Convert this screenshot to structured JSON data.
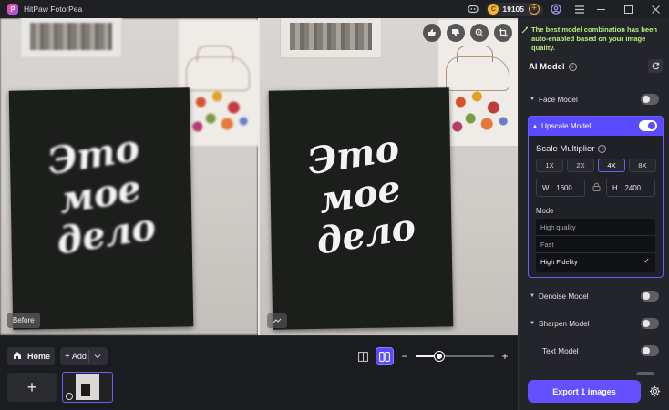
{
  "app": {
    "title": "HitPaw FotorPea",
    "logo_letter": "P"
  },
  "titlebar": {
    "credits": "19105",
    "coin_symbol": "C"
  },
  "viewer": {
    "before_label": "Before",
    "after_chip": "",
    "board_text": "Это\nмое\nдело",
    "tools": [
      "thumbs-up-icon",
      "thumbs-down-icon",
      "zoom-icon",
      "crop-icon"
    ]
  },
  "bottom": {
    "home_label": "Home",
    "add_label": "Add",
    "new_slot_symbol": "+",
    "zoom_minus": "−",
    "zoom_plus": "+",
    "zoom_level": 0.3
  },
  "panel": {
    "notice": "The best model combination has been auto-enabled based on your image quality.",
    "ai_model_title": "AI Model",
    "models": [
      {
        "label": "Face Model",
        "enabled": false
      },
      {
        "label": "Upscale Model",
        "enabled": true
      },
      {
        "label": "Denoise Model",
        "enabled": false
      },
      {
        "label": "Sharpen Model",
        "enabled": false
      },
      {
        "label": "Text Model",
        "enabled": false
      }
    ],
    "upscale": {
      "scale_title": "Scale Multiplier",
      "scales": [
        "1X",
        "2X",
        "4X",
        "8X"
      ],
      "selected_scale": "4X",
      "width_label": "W",
      "width_value": "1600",
      "height_label": "H",
      "height_value": "2400",
      "mode_title": "Mode",
      "modes": [
        "High quality",
        "Fast",
        "High Fidelity"
      ],
      "selected_mode": "High Fidelity"
    },
    "export_label": "Export 1 images"
  },
  "colors": {
    "accent": "#6450ff",
    "notice": "#b7f07a",
    "coin": "#f5b52b"
  }
}
